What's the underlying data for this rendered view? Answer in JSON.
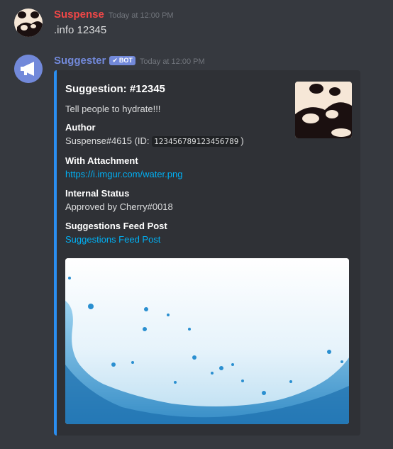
{
  "messages": [
    {
      "username": "Suspense",
      "username_color": "#f04747",
      "timestamp": "Today at 12:00 PM",
      "text": ".info 12345"
    },
    {
      "username": "Suggester",
      "username_color": "#7289da",
      "bot_badge": "BOT",
      "timestamp": "Today at 12:00 PM"
    }
  ],
  "embed": {
    "accent_color": "#2a8ef0",
    "title": "Suggestion: #12345",
    "description": "Tell people to hydrate!!!",
    "fields": [
      {
        "name": "Author",
        "value_prefix": "Suspense#4615 (ID: ",
        "value_code": "123456789123456789",
        "value_suffix": ")"
      },
      {
        "name": "With Attachment",
        "value_link": "https://i.imgur.com/water.png"
      },
      {
        "name": "Internal Status",
        "value": "Approved by Cherry#0018"
      },
      {
        "name": "Suggestions Feed Post",
        "value_link": "Suggestions Feed Post"
      }
    ],
    "thumbnail_icon": "panda-icon",
    "image_icon": "water-splash-image"
  }
}
